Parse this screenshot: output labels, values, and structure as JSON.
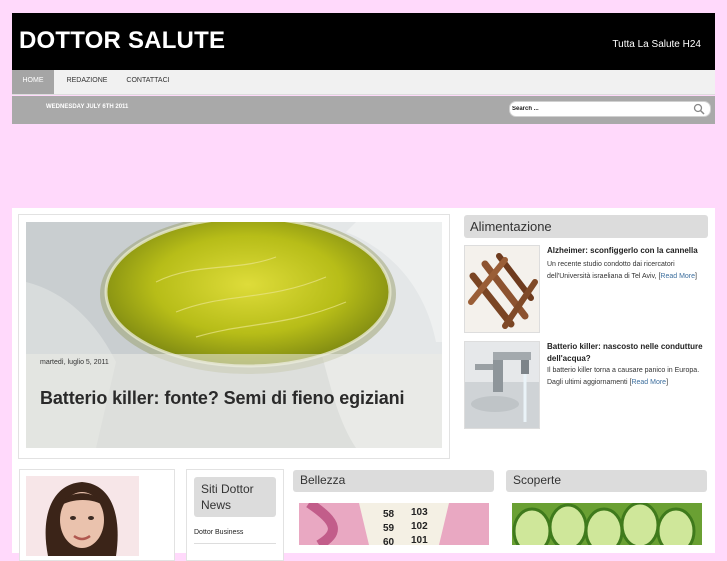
{
  "header": {
    "site_title": "DOTTOR SALUTE",
    "tagline": "Tutta La Salute H24"
  },
  "nav": {
    "items": [
      {
        "label": "HOME"
      },
      {
        "label": "REDAZIONE"
      },
      {
        "label": "CONTATTACI"
      }
    ]
  },
  "datebar": {
    "date": "WEDNESDAY JULY 6TH 2011",
    "search_value": "Search ..."
  },
  "featured": {
    "date": "martedì, luglio 5, 2011",
    "title": "Batterio killer: fonte? Semi di fieno egiziani"
  },
  "sidebar": {
    "heading": "Alimentazione",
    "posts": [
      {
        "title": "Alzheimer: sconfiggerlo con la cannella",
        "excerpt": "Un recente studio condotto dai ricercatori dell'Università israeliana di Tel Aviv, [",
        "read_more": "Read More",
        "close": "]"
      },
      {
        "title": "Batterio killer: nascosto nelle condutture dell'acqua?",
        "excerpt": "Il batterio killer torna a causare panico in Europa. Dagli ultimi aggiornamenti [",
        "read_more": "Read More",
        "close": "]"
      }
    ]
  },
  "bottom": {
    "siti_heading": "Siti Dottor News",
    "siti_link": "Dottor Business",
    "bellezza_heading": "Bellezza",
    "scoperte_heading": "Scoperte",
    "tape_numbers": [
      "58",
      "103",
      "59",
      "102",
      "60",
      "101"
    ]
  },
  "colors": {
    "page_background": "#ffd9fb",
    "header_background": "#000000",
    "nav_active": "#a5a5a5",
    "datebar": "#a9a9a9",
    "link": "#3d6f9e"
  }
}
